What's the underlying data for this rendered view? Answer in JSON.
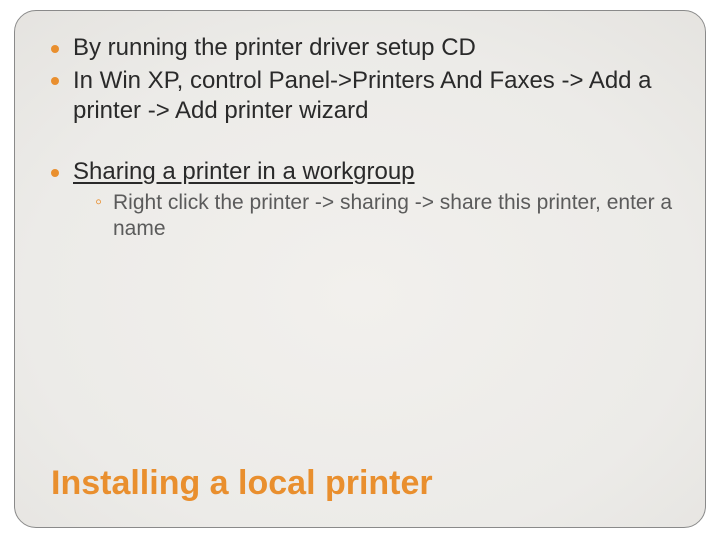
{
  "bullets": [
    "By running the printer driver setup CD",
    "In Win XP, control Panel->Printers And Faxes -> Add a printer -> Add printer wizard"
  ],
  "section": {
    "heading": "Sharing a printer in a workgroup",
    "sub": [
      "Right click the printer -> sharing -> share this printer, enter a name"
    ]
  },
  "title": "Installing a local printer",
  "colors": {
    "accent": "#e98f2e"
  }
}
